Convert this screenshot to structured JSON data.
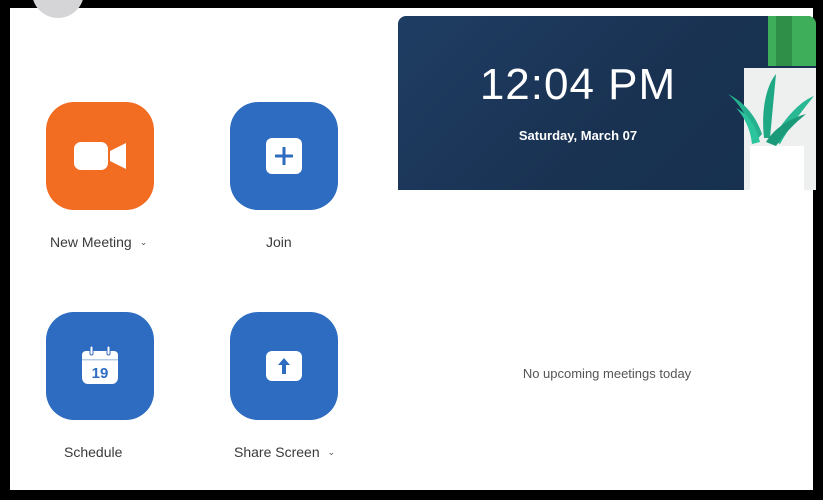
{
  "actions": {
    "new_meeting": {
      "label": "New Meeting",
      "icon": "video-camera-icon",
      "color": "#f26d21"
    },
    "join": {
      "label": "Join",
      "icon": "plus-icon",
      "color": "#2d6cc0"
    },
    "schedule": {
      "label": "Schedule",
      "icon": "calendar-icon",
      "calendar_day": "19",
      "color": "#2d6cc0"
    },
    "share_screen": {
      "label": "Share Screen",
      "icon": "upload-arrow-icon",
      "color": "#2d6cc0"
    }
  },
  "clock": {
    "time": "12:04 PM",
    "date": "Saturday, March 07"
  },
  "meetings": {
    "empty_text": "No upcoming meetings today"
  }
}
